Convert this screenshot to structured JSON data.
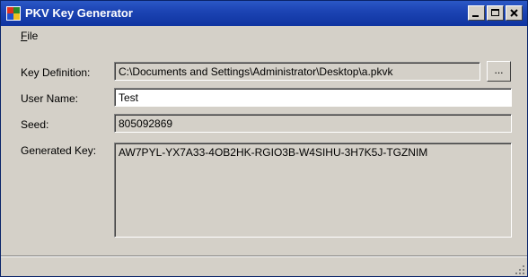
{
  "window": {
    "title": "PKV Key Generator"
  },
  "menu": {
    "file_prefix": "F",
    "file_rest": "ile"
  },
  "form": {
    "key_definition_label": "Key Definition:",
    "key_definition_value": "C:\\Documents and Settings\\Administrator\\Desktop\\a.pkvk",
    "browse_label": "...",
    "user_name_label": "User Name:",
    "user_name_value": "Test",
    "seed_label": "Seed:",
    "seed_value": "805092869",
    "generated_key_label": "Generated Key:",
    "generated_key_value": "AW7PYL-YX7A33-4OB2HK-RGIO3B-W4SIHU-3H7K5J-TGZNIM"
  },
  "colors": {
    "title_bar": "#0f34a0",
    "face": "#d4d0c8"
  }
}
